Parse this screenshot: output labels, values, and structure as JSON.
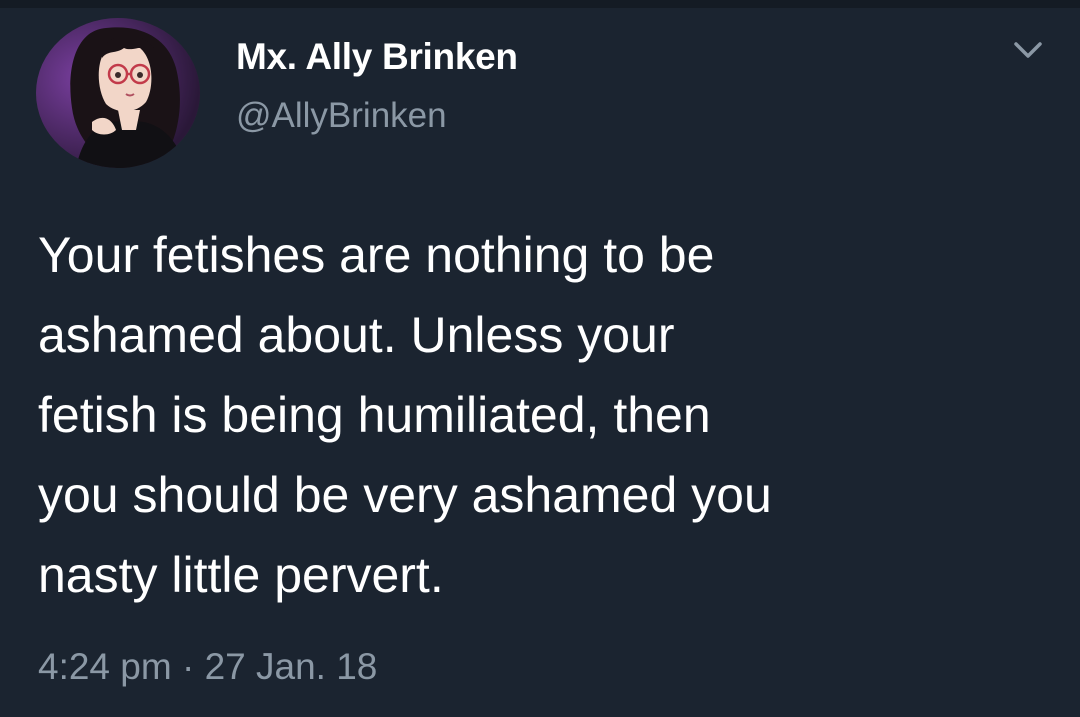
{
  "tweet": {
    "author": {
      "display_name": "Mx. Ally Brinken",
      "handle": "@AllyBrinken",
      "avatar_icon": "illustrated-portrait-avatar"
    },
    "menu_icon": "chevron-down-icon",
    "text_lines": [
      "Your fetishes are nothing to be",
      "ashamed about. Unless your",
      "fetish is being humiliated, then",
      "you should be very ashamed you",
      "nasty little pervert."
    ],
    "timestamp": "4:24 pm · 27 Jan. 18"
  },
  "colors": {
    "background": "#1b2430",
    "primary_text": "#ffffff",
    "secondary_text": "#8b98a5"
  }
}
